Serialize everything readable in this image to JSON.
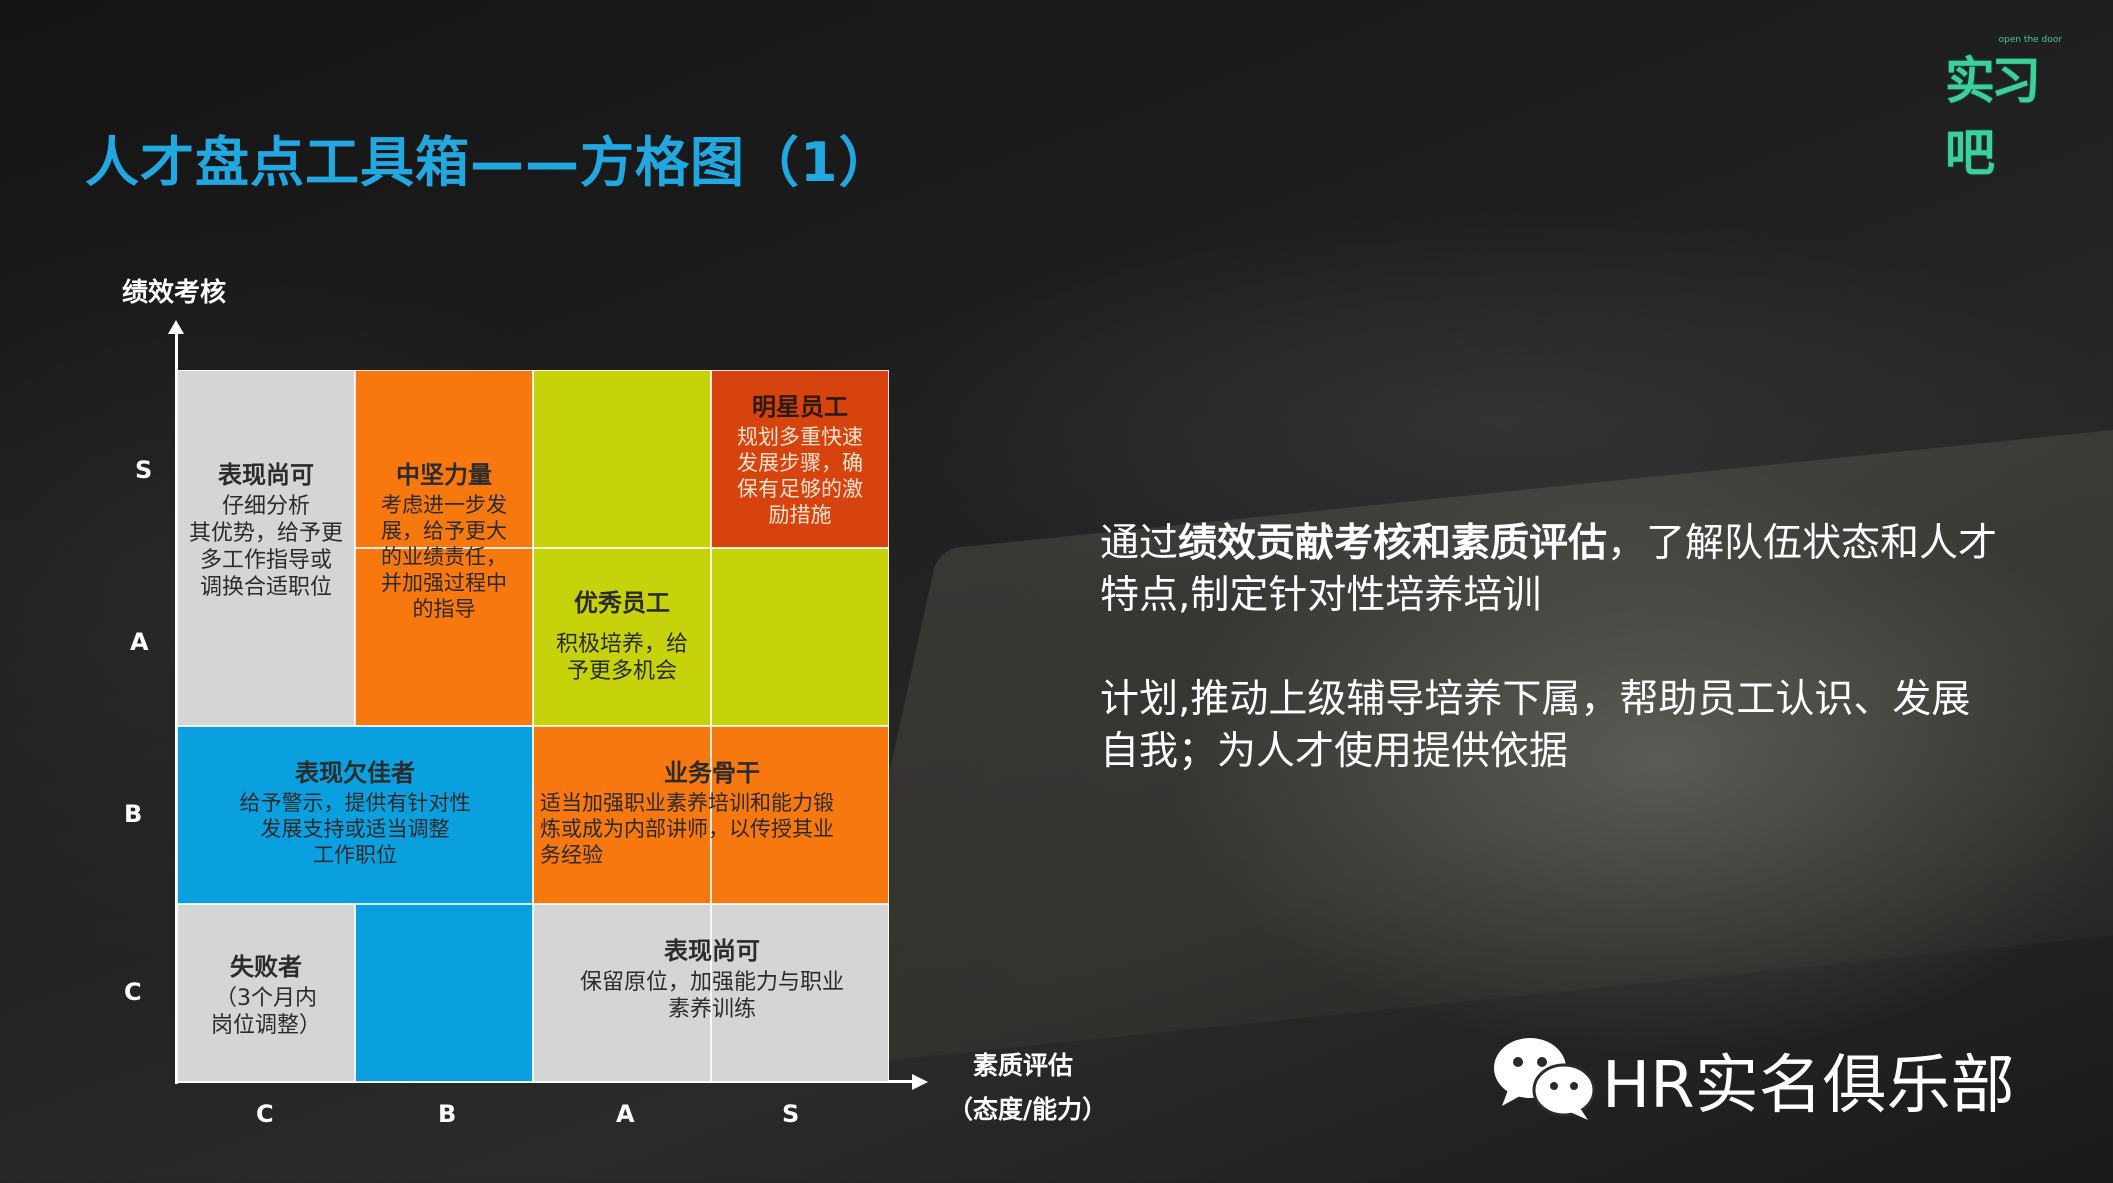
{
  "logo": {
    "small": "open the door",
    "main": "实习吧"
  },
  "title": "人才盘点工具箱——方格图（1）",
  "chart": {
    "y_axis_label": "绩效考核",
    "x_axis_label": "素质评估",
    "x_axis_sublabel": "（态度/能力）",
    "y_ticks": [
      "S",
      "A",
      "B",
      "C"
    ],
    "x_ticks": [
      "C",
      "B",
      "A",
      "S"
    ],
    "blocks": {
      "biaoxian_top": {
        "title": "表现尚可",
        "lines": [
          "仔细分析",
          "其优势，给予更",
          "多工作指导或",
          "调换合适职位"
        ]
      },
      "zhongjian": {
        "title": "中坚力量",
        "lines": [
          "考虑进一步发",
          "展，给予更大",
          "的业绩责任，",
          "并加强过程中",
          "的指导"
        ]
      },
      "mingxing": {
        "title": "明星员工",
        "lines": [
          "规划多重快速",
          "发展步骤，确",
          "保有足够的激",
          "励措施"
        ]
      },
      "youxiu": {
        "title": "优秀员工",
        "lines": [
          "积极培养，给",
          "予更多机会"
        ]
      },
      "qianjia": {
        "title": "表现欠佳者",
        "lines": [
          "给予警示，提供有针对性",
          "发展支持或适当调整",
          "工作职位"
        ]
      },
      "gugan": {
        "title": "业务骨干",
        "lines": [
          "适当加强职业素养培训和能力锻",
          "炼或成为内部讲师，以传授其业",
          "务经验"
        ]
      },
      "shibai": {
        "title": "失败者",
        "lines": [
          "（3个月内",
          "岗位调整）"
        ]
      },
      "biaoxian_bottom": {
        "title": "表现尚可",
        "lines": [
          "保留原位，加强能力与职业",
          "素养训练"
        ]
      }
    }
  },
  "paragraph1": {
    "pre": "通过",
    "bold": "绩效贡献考核和素质评估",
    "post": "，了解队伍状态和人才特点,制定针对性培养培训"
  },
  "paragraph2": "计划,推动上级辅导培养下属，帮助员工认识、发展自我；为人才使用提供依据",
  "brand": "HR实名俱乐部"
}
